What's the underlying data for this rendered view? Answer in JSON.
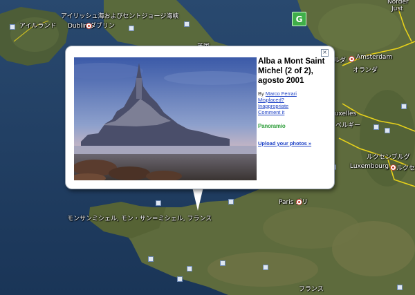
{
  "balloon": {
    "title": "Alba a Mont Saint Michel (2 of 2), agosto 2001",
    "by_prefix": "By",
    "author": "Marco Ferrari",
    "misplaced": "Misplaced?",
    "inappropriate": "Inappropriate",
    "comment": "Comment it",
    "panoramio_logo": "Panoramio",
    "upload": "Upload your photos »",
    "close_glyph": "×"
  },
  "map_labels": {
    "irish_sea": "アイリッシュ海およびセントジョージ海峡",
    "ireland": "アイルランド",
    "dublin": "Dublin ダブリン",
    "uk": "英国",
    "amsterdam": "Amsterdam",
    "netherlands": "オランダ",
    "netherlands_partial": "ルダ",
    "bruxelles": "ruxelles",
    "belgium": "ベルギー",
    "luxembourg_jp": "ルクセンブルグ",
    "luxembourg": "Luxembourg",
    "luxembourg_jp2": "ルクセ",
    "paris": "Paris パリ",
    "mont_st_michel": "モンサンミシェル, モン・サン＝ミシェル, フランス",
    "france": "フランス",
    "north_sea": "Norder",
    "north_sea2": "Just"
  },
  "colors": {
    "sea": "#1f3f63",
    "border": "#e8d21a",
    "link": "#1a3fc5",
    "panoramio": "#2f9e3b"
  },
  "icons": {
    "g_button": "G"
  }
}
